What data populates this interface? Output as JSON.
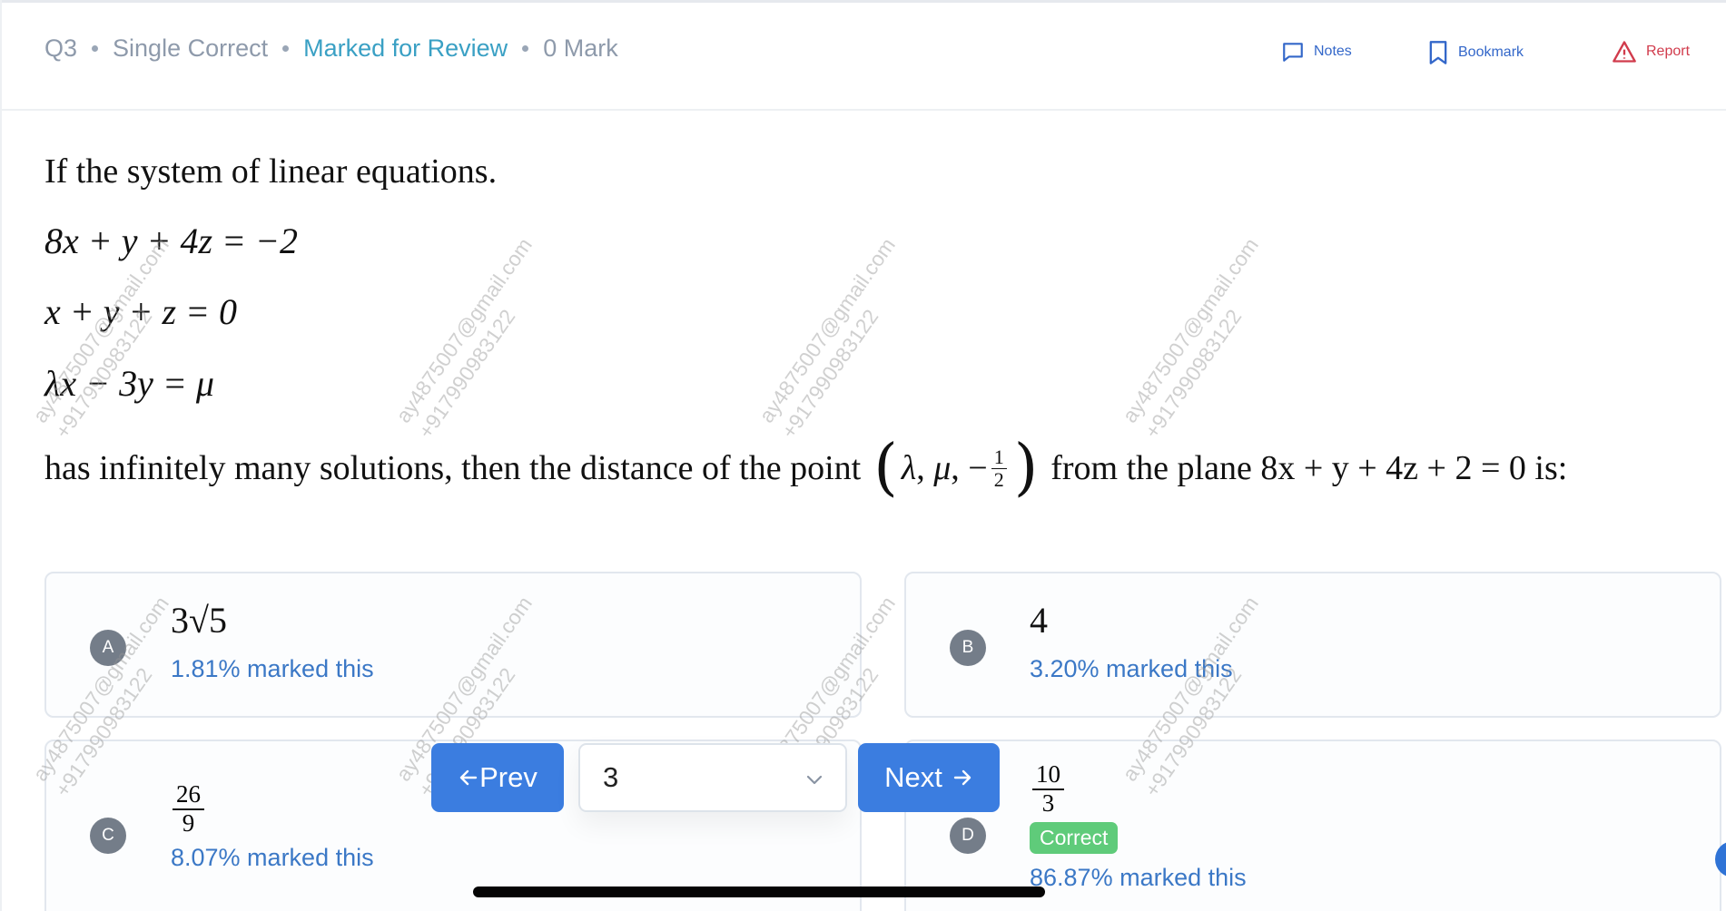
{
  "header": {
    "question_no": "Q3",
    "question_type": "Single Correct",
    "status": "Marked for Review",
    "marks": "0 Mark",
    "actions": {
      "notes": "Notes",
      "bookmark": "Bookmark",
      "report": "Report"
    }
  },
  "question": {
    "intro": "If the system of linear equations.",
    "equations": [
      "8x + y + 4z = −2",
      "x + y + z = 0",
      "λx − 3y = μ"
    ],
    "tail_before": "has infinitely many solutions, then the distance of the point",
    "point": {
      "lambda": "λ",
      "mu": "μ",
      "neg": "−",
      "frac_num": "1",
      "frac_den": "2"
    },
    "tail_after": "from the plane 8x + y + 4z + 2 = 0 is:"
  },
  "options": {
    "a": {
      "letter": "A",
      "value": "3√5",
      "stat": "1.81% marked this"
    },
    "b": {
      "letter": "B",
      "value": "4",
      "stat": "3.20% marked this"
    },
    "c": {
      "letter": "C",
      "num": "26",
      "den": "9",
      "stat": "8.07% marked this"
    },
    "d": {
      "letter": "D",
      "num": "10",
      "den": "3",
      "tag": "Correct",
      "stat": "86.87% marked this"
    }
  },
  "nav": {
    "prev": "Prev",
    "next": "Next",
    "current": "3"
  },
  "watermark": {
    "line1": "ay4875007@gmail.com",
    "line2": "+917990983122"
  },
  "icons": {
    "notes": "chat-bubble-icon",
    "bookmark": "bookmark-icon",
    "report": "warning-triangle-icon",
    "prev": "arrow-left-icon",
    "next": "arrow-right-icon",
    "select": "chevron-down-icon"
  },
  "colors": {
    "accent": "#3b7de0",
    "review": "#3aa0c4",
    "report": "#d13b4c",
    "correct": "#5fcb7a",
    "stat": "#3b78c6"
  }
}
